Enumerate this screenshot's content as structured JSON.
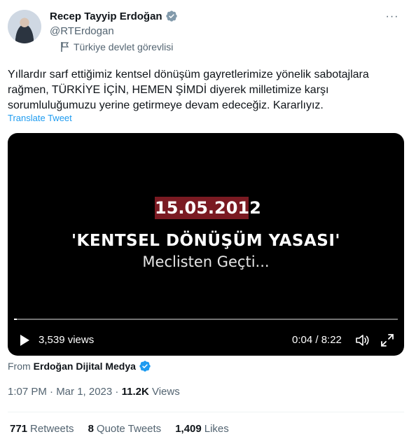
{
  "author": {
    "name": "Recep Tayyip Erdoğan",
    "handle": "@RTErdogan",
    "label": "Türkiye devlet görevlisi"
  },
  "tweet": {
    "text": "Yıllardır sarf ettiğimiz kentsel dönüşüm gayretlerimize yönelik sabotajlara rağmen, TÜRKİYE İÇİN, HEMEN ŞİMDİ diyerek milletimize karşı sorumluluğumuzu yerine getirmeye devam edeceğiz. Kararlıyız.",
    "translate": "Translate Tweet"
  },
  "video": {
    "date": "15.05.2012",
    "title": "'KENTSEL DÖNÜŞÜM YASASI'",
    "subtitle": "Meclisten Geçti...",
    "views": "3,539 views",
    "time": "0:04 / 8:22",
    "progress": 0.008
  },
  "source": {
    "prefix": "From",
    "name": "Erdoğan Dijital Medya"
  },
  "meta": {
    "datetime": "1:07 PM · Mar 1, 2023",
    "views_count": "11.2K",
    "views_label": "Views"
  },
  "stats": {
    "retweets_count": "771",
    "retweets_label": "Retweets",
    "quotes_count": "8",
    "quotes_label": "Quote Tweets",
    "likes_count": "1,409",
    "likes_label": "Likes"
  },
  "colors": {
    "accent": "#1d9bf0",
    "secondary_text": "#536471",
    "date_box": "#7a1a22"
  }
}
